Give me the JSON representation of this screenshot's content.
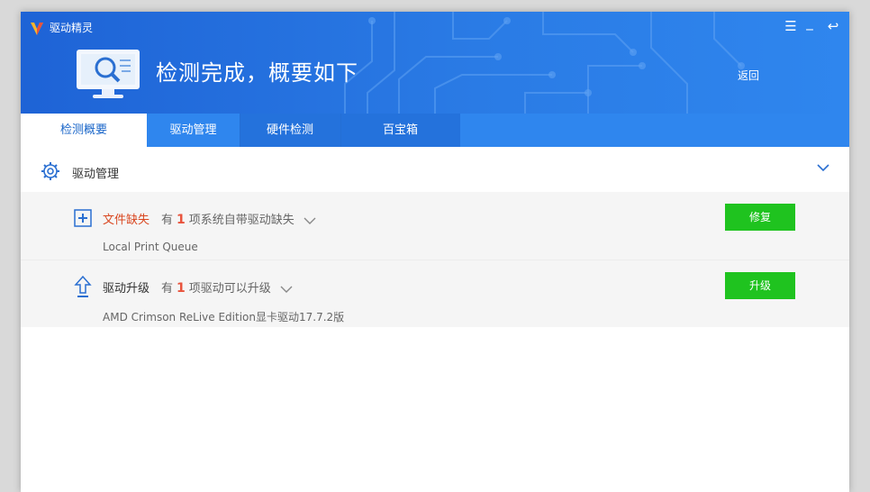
{
  "app": {
    "title": "驱动精灵"
  },
  "window_controls": {
    "menu": "☰",
    "minimize": "_",
    "back": "↩"
  },
  "hero": {
    "title": "检测完成，概要如下",
    "back_label": "返回"
  },
  "tabs": [
    {
      "label": "检测概要",
      "active": true
    },
    {
      "label": "驱动管理",
      "active": false
    },
    {
      "label": "硬件检测",
      "active": false
    },
    {
      "label": "百宝箱",
      "active": false
    }
  ],
  "section": {
    "title": "驱动管理"
  },
  "items": [
    {
      "title": "文件缺失",
      "title_color": "#d9461f",
      "desc_prefix": "有",
      "count": "1",
      "desc_suffix": "项系统自带驱动缺失",
      "sub": "Local Print Queue",
      "button": "修复"
    },
    {
      "title": "驱动升级",
      "title_color": "#333333",
      "desc_prefix": "有",
      "count": "1",
      "desc_suffix": "项驱动可以升级",
      "sub": "AMD Crimson ReLive Edition显卡驱动17.7.2版",
      "button": "升级"
    }
  ],
  "colors": {
    "header": "#1e63d6",
    "tabbar": "#2f86ee",
    "accent_button": "#1fc31f",
    "count": "#e8533c"
  }
}
